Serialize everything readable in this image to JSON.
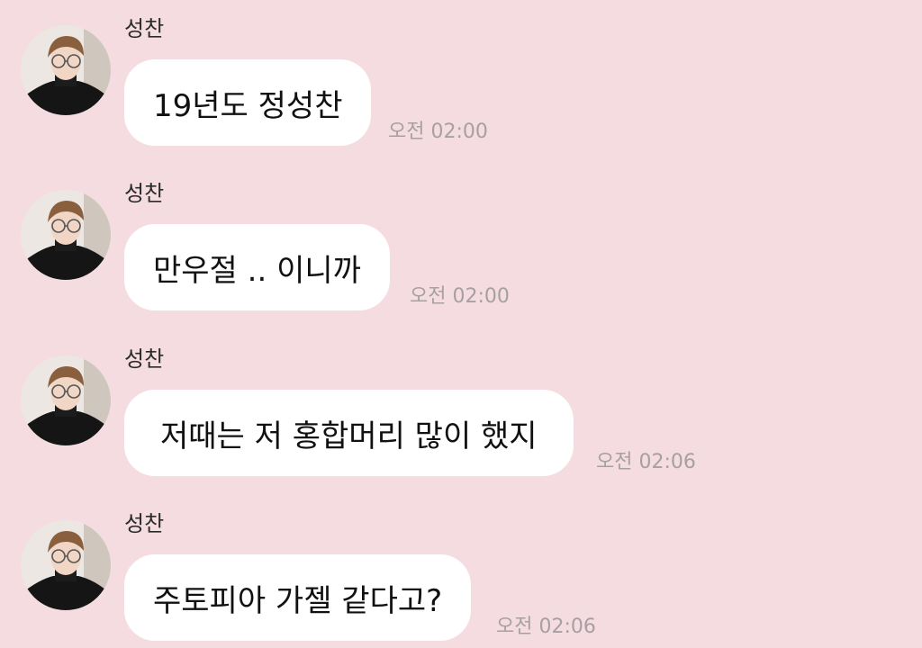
{
  "messages": [
    {
      "sender": "성찬",
      "text": "19년도 정성찬",
      "time": "오전 02:00"
    },
    {
      "sender": "성찬",
      "text": "만우절 .. 이니까",
      "time": "오전 02:00"
    },
    {
      "sender": "성찬",
      "text": "저때는 저 홍합머리 많이 했지",
      "time": "오전 02:06"
    },
    {
      "sender": "성찬",
      "text": "주토피아 가젤 같다고?",
      "time": "오전 02:06"
    }
  ],
  "colors": {
    "background": "#f5dce1",
    "bubble": "#ffffff",
    "timestamp": "#a7a0a2"
  },
  "icons": {
    "avatar": "profile-photo"
  }
}
